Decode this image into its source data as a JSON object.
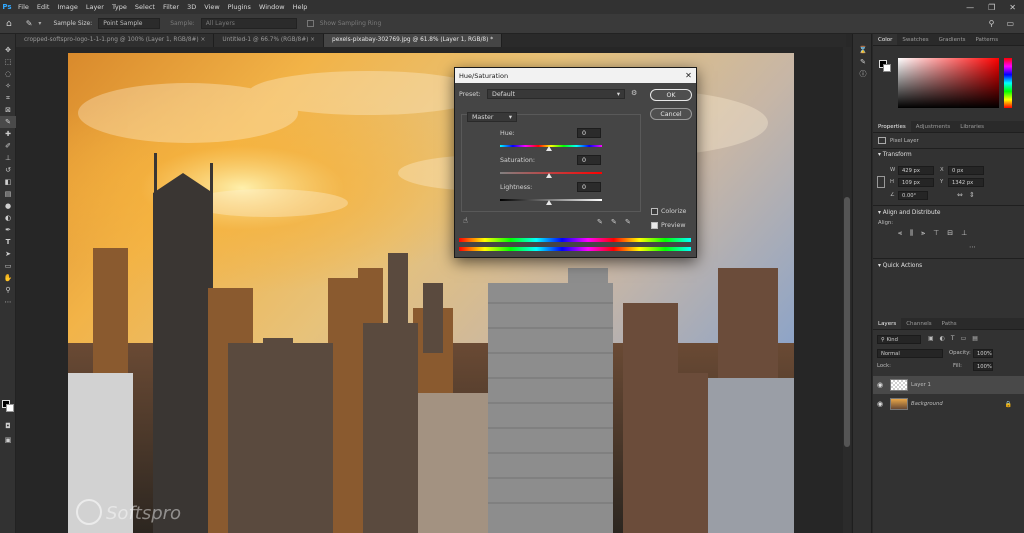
{
  "menu": {
    "logo": "Ps",
    "items": [
      "File",
      "Edit",
      "Image",
      "Layer",
      "Type",
      "Select",
      "Filter",
      "3D",
      "View",
      "Plugins",
      "Window",
      "Help"
    ],
    "controls": [
      "—",
      "❐",
      "✕"
    ]
  },
  "options": {
    "sample_size_label": "Sample Size:",
    "sample_size_value": "Point Sample",
    "sample_label": "Sample:",
    "sample_value": "All Layers",
    "show_ring_label": "Show Sampling Ring"
  },
  "tabs": [
    "cropped-softspro-logo-1-1-1.png @ 100% (Layer 1, RGB/8#) ×",
    "Untitled-1 @ 66.7% (RGB/8#) ×",
    "pexels-pixabay-302769.jpg @ 61.8% (Layer 1, RGB/8) *"
  ],
  "watermark": "Softspro",
  "dialog": {
    "title": "Hue/Saturation",
    "preset_label": "Preset:",
    "preset_value": "Default",
    "ok": "OK",
    "cancel": "Cancel",
    "channel": "Master",
    "hue_label": "Hue:",
    "hue_value": "0",
    "saturation_label": "Saturation:",
    "saturation_value": "0",
    "lightness_label": "Lightness:",
    "lightness_value": "0",
    "colorize_label": "Colorize",
    "preview_label": "Preview"
  },
  "color_panel": {
    "tabs": [
      "Color",
      "Swatches",
      "Gradients",
      "Patterns"
    ]
  },
  "properties": {
    "tabs": [
      "Properties",
      "Adjustments",
      "Libraries"
    ],
    "type": "Pixel Layer",
    "transform_title": "Transform",
    "w_label": "W",
    "w_value": "429 px",
    "x_label": "X",
    "x_value": "0 px",
    "h_label": "H",
    "h_value": "109 px",
    "y_label": "Y",
    "y_value": "1342 px",
    "angle_value": "0.00°",
    "align_title": "Align and Distribute",
    "align_label": "Align:",
    "quick_title": "Quick Actions"
  },
  "layers": {
    "tabs": [
      "Layers",
      "Channels",
      "Paths"
    ],
    "kind": "Kind",
    "blend": "Normal",
    "opacity_label": "Opacity:",
    "opacity_value": "100%",
    "lock_label": "Lock:",
    "fill_label": "Fill:",
    "fill_value": "100%",
    "rows": [
      {
        "name": "Layer 1"
      },
      {
        "name": "Background"
      }
    ]
  }
}
